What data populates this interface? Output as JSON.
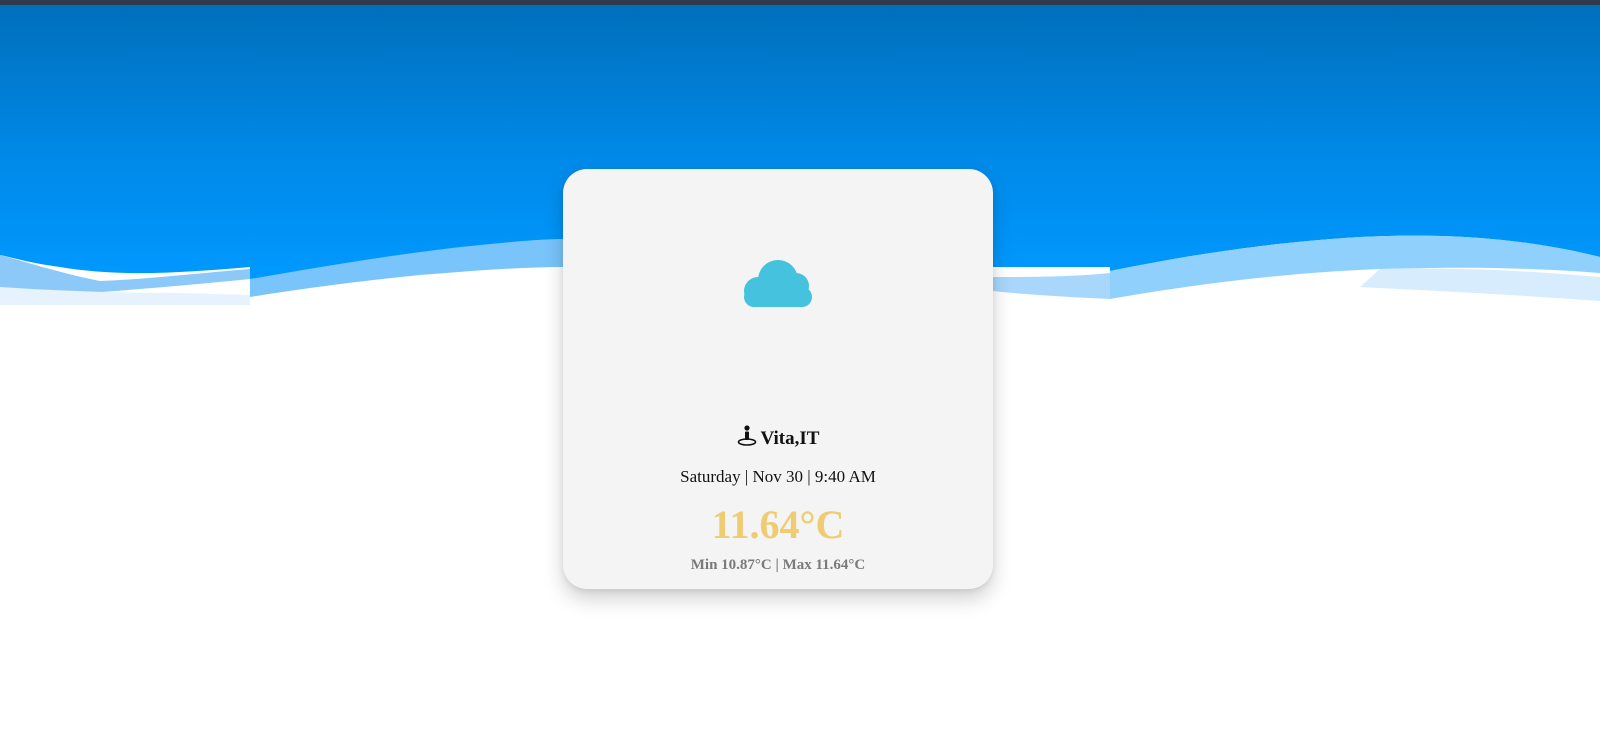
{
  "weather": {
    "icon": "cloud-icon",
    "location": "Vita,IT",
    "datetime": "Saturday | Nov 30 | 9:40 AM",
    "temperature": "11.64°C",
    "minmax": "Min 10.87°C | Max 11.64°C"
  },
  "colors": {
    "sky_top": "#0066b3",
    "sky_bottom": "#008df2",
    "cloud": "#45c2dd",
    "temperature": "#efcb72",
    "card_bg": "#f4f4f4"
  }
}
